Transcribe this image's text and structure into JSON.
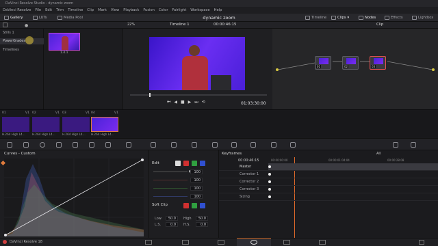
{
  "window": {
    "title": "DaVinci Resolve Studio - dynamic zoom"
  },
  "menu": [
    "DaVinci Resolve",
    "File",
    "Edit",
    "Trim",
    "Timeline",
    "Clip",
    "Mark",
    "View",
    "Playback",
    "Fusion",
    "Color",
    "Fairlight",
    "Workspace",
    "Help"
  ],
  "toolbar": {
    "gallery": "Gallery",
    "luts": "LUTs",
    "media_pool": "Media Pool",
    "project_title": "dynamic zoom",
    "timeline": "Timeline",
    "clips": "Clips",
    "nodes": "Nodes",
    "effects": "Effects",
    "lightbox": "Lightbox"
  },
  "subbar": {
    "zoom": "22%",
    "timeline_name": "Timeline 1",
    "timecode": "00:00:46:15",
    "clip_mode": "Clip"
  },
  "gallery_panel": {
    "items": [
      "Stills 1",
      "PowerGrades",
      "Timelines"
    ],
    "selected": "PowerGrades",
    "still_label": "1.4.1"
  },
  "viewer": {
    "timecode": "01:03:30:00"
  },
  "nodes": [
    {
      "label": "01"
    },
    {
      "label": "02"
    },
    {
      "label": "03"
    }
  ],
  "clips": [
    {
      "num": "01",
      "track": "V1",
      "caption": "H.264 High L4..."
    },
    {
      "num": "02",
      "track": "V1",
      "caption": "H.264 High L4..."
    },
    {
      "num": "03",
      "track": "V1",
      "caption": "H.264 High L4..."
    },
    {
      "num": "04",
      "track": "V1",
      "caption": "H.264 High L4..."
    }
  ],
  "curves": {
    "title": "Curves - Custom"
  },
  "edit": {
    "title": "Edit",
    "values": [
      "100",
      "100",
      "100",
      "100"
    ],
    "softclip_title": "Soft Clip",
    "low_label": "Low",
    "low_value": "50.0",
    "high_label": "High",
    "high_value": "50.0",
    "ls_label": "L.S.",
    "ls_value": "0.0",
    "hs_label": "H.S.",
    "hs_value": "0.0"
  },
  "keyframes": {
    "title": "Keyframes",
    "filter": "All",
    "timecode": "00:00:46:15",
    "ruler": [
      "00:00:00:00",
      "00:00:01:04:04",
      "00:00:28:08"
    ],
    "rows": [
      "Master",
      "Corrector 1",
      "Corrector 2",
      "Corrector 3",
      "Sizing"
    ]
  },
  "status": {
    "app": "DaVinci Resolve 18"
  },
  "colors": {
    "accent": "#e07b3c",
    "selection": "#c94ad8",
    "playhead": "#e06a2a"
  }
}
